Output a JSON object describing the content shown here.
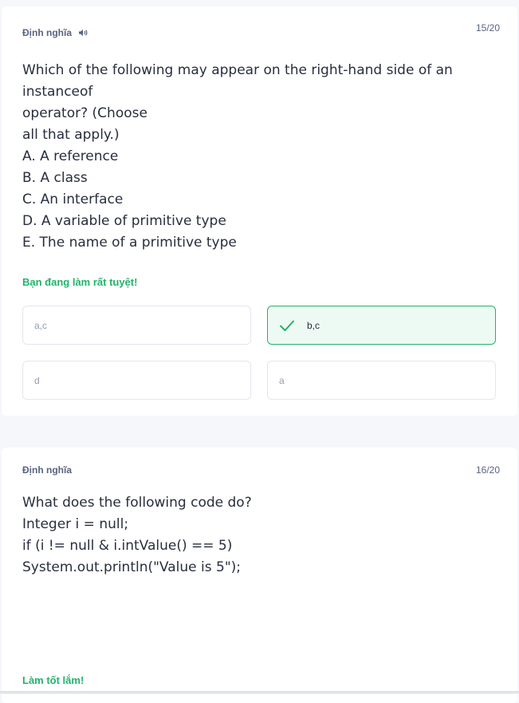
{
  "cards": [
    {
      "term_label": "Định nghĩa",
      "counter": "15/20",
      "question_lines": [
        "Which of the following may appear on the right-hand side of an instanceof",
        "operator? (Choose",
        "all that apply.)",
        "A. A reference",
        "B. A class",
        "C. An interface",
        "D. A variable of primitive type",
        "E. The name of a primitive type"
      ],
      "feedback": "Bạn đang làm rất tuyệt!",
      "options": [
        {
          "label": "a,c",
          "state": "default"
        },
        {
          "label": "b,c",
          "state": "correct"
        },
        {
          "label": "d",
          "state": "default"
        },
        {
          "label": "a",
          "state": "default"
        }
      ]
    },
    {
      "term_label": "Định nghĩa",
      "counter": "16/20",
      "question_lines": [
        "What does the following code do?",
        "Integer i = null;",
        "if (i != null & i.intValue() == 5)",
        "System.out.println(\"Value is 5\");"
      ],
      "feedback": "Làm tốt lắm!"
    }
  ],
  "colors": {
    "correct": "#23b26d",
    "correct_bg": "#edfaf3",
    "muted_text": "#586380",
    "option_text": "#939bb4"
  },
  "icons": {
    "audio": "speaker-icon",
    "check": "check-icon"
  }
}
